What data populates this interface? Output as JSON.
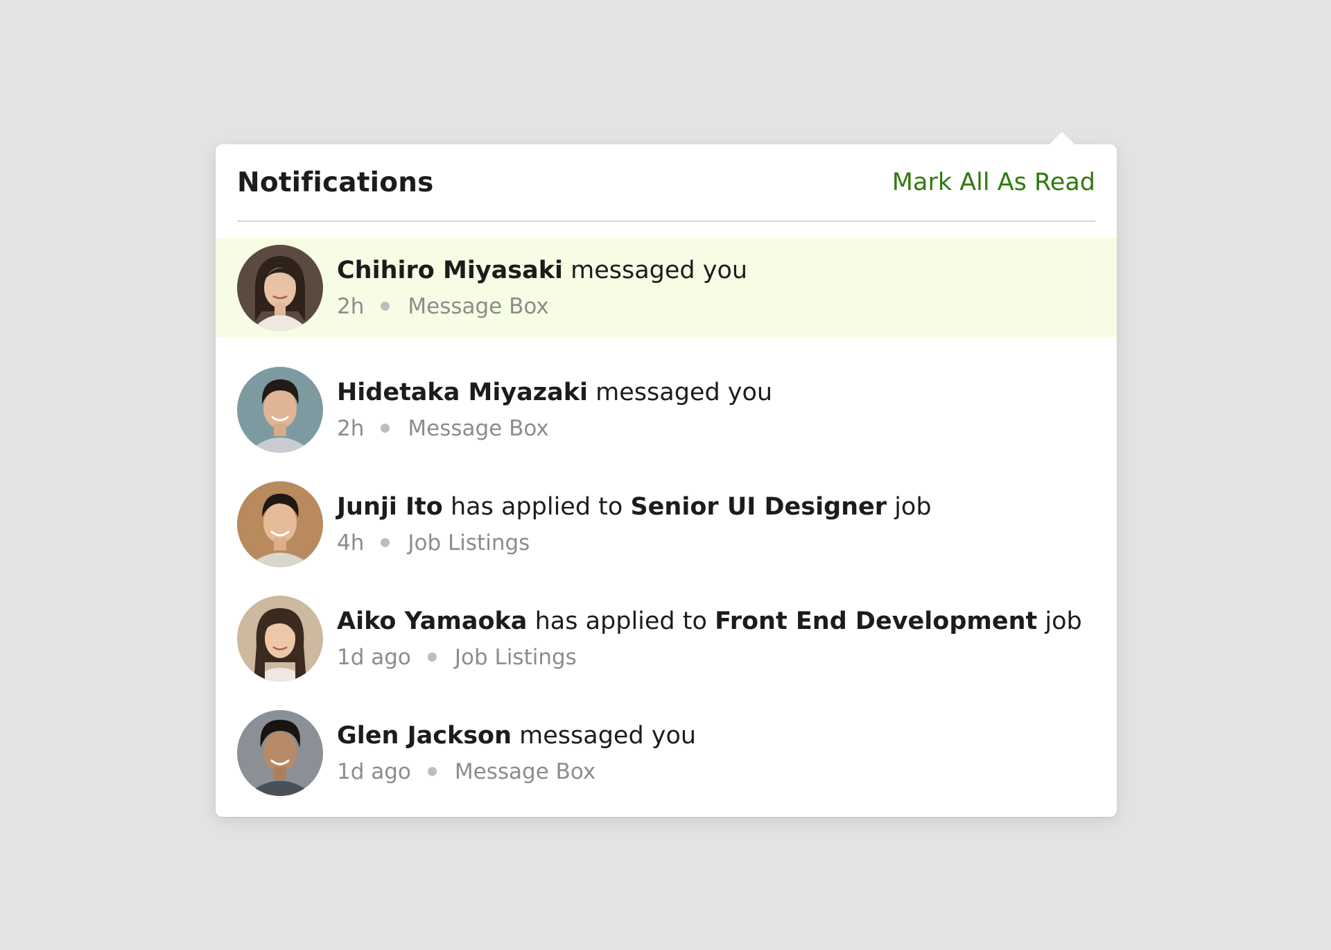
{
  "panel": {
    "title": "Notifications",
    "mark_all_label": "Mark All As Read"
  },
  "colors": {
    "accent": "#2f7a0e",
    "unread_bg": "#f6fde4",
    "background": "#e3e3e3"
  },
  "notifications": [
    {
      "actor": "Chihiro Miyasaki",
      "action": "messaged you",
      "target": "",
      "suffix": "",
      "time": "2h",
      "source": "Message Box",
      "unread": true
    },
    {
      "actor": "Hidetaka Miyazaki",
      "action": "messaged you",
      "target": "",
      "suffix": "",
      "time": "2h",
      "source": "Message Box",
      "unread": false
    },
    {
      "actor": "Junji Ito",
      "action": "has applied to",
      "target": "Senior UI Designer",
      "suffix": "job",
      "time": "4h",
      "source": "Job Listings",
      "unread": false
    },
    {
      "actor": "Aiko Yamaoka",
      "action": "has applied to",
      "target": "Front End Development",
      "suffix": "job",
      "time": "1d ago",
      "source": "Job Listings",
      "unread": false
    },
    {
      "actor": "Glen Jackson",
      "action": "messaged you",
      "target": "",
      "suffix": "",
      "time": "1d ago",
      "source": "Message Box",
      "unread": false
    }
  ]
}
